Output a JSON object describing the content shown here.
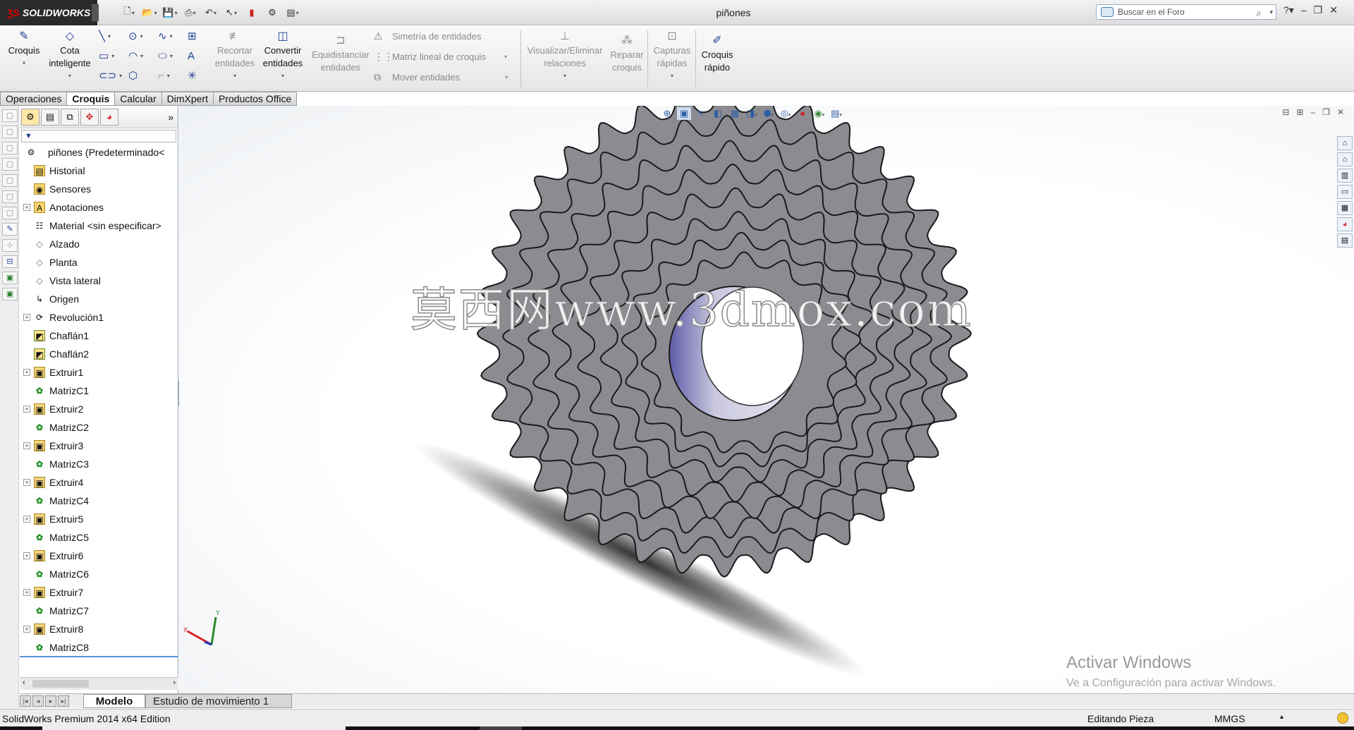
{
  "app": {
    "brand": "SOLIDWORKS",
    "doc_title": "piñones",
    "search_placeholder": "Buscar en el Foro"
  },
  "quick_toolbar": [
    "new-document-icon",
    "open-icon",
    "save-icon",
    "print-icon",
    "undo-icon",
    "select-icon",
    "rebuild-icon",
    "options-icon",
    "customize-icon"
  ],
  "ribbon": {
    "croquis": "Croquis",
    "cota": "Cota inteligente",
    "recortar": "Recortar entidades",
    "convertir": "Convertir entidades",
    "equidistanciar": "Equidistanciar entidades",
    "simetria": "Simetría de entidades",
    "matriz_lineal": "Matriz lineal de croquis",
    "mover": "Mover entidades",
    "visualizar": "Visualizar/Eliminar relaciones",
    "reparar": "Reparar croquis",
    "capturas": "Capturas rápidas",
    "croquis_rapido": "Croquis rápido"
  },
  "command_tabs": [
    "Operaciones",
    "Croquis",
    "Calcular",
    "DimXpert",
    "Productos Office"
  ],
  "active_tab": "Croquis",
  "tree": {
    "root": "piñones  (Predeterminado<",
    "items": [
      {
        "label": "Historial",
        "icon": "history-folder-icon",
        "expand": false
      },
      {
        "label": "Sensores",
        "icon": "sensor-folder-icon",
        "expand": false
      },
      {
        "label": "Anotaciones",
        "icon": "annotations-icon",
        "expand": true
      },
      {
        "label": "Material <sin especificar>",
        "icon": "material-icon",
        "expand": false
      },
      {
        "label": "Alzado",
        "icon": "plane-icon",
        "expand": false
      },
      {
        "label": "Planta",
        "icon": "plane-icon",
        "expand": false
      },
      {
        "label": "Vista lateral",
        "icon": "plane-icon",
        "expand": false
      },
      {
        "label": "Origen",
        "icon": "origin-icon",
        "expand": false
      },
      {
        "label": "Revolución1",
        "icon": "revolve-icon",
        "expand": true
      },
      {
        "label": "Chaflán1",
        "icon": "chamfer-icon",
        "expand": false
      },
      {
        "label": "Chaflán2",
        "icon": "chamfer-icon",
        "expand": false
      },
      {
        "label": "Extruir1",
        "icon": "extrude-icon",
        "expand": true
      },
      {
        "label": "MatrizC1",
        "icon": "circular-pattern-icon",
        "expand": false
      },
      {
        "label": "Extruir2",
        "icon": "extrude-icon",
        "expand": true
      },
      {
        "label": "MatrizC2",
        "icon": "circular-pattern-icon",
        "expand": false
      },
      {
        "label": "Extruir3",
        "icon": "extrude-icon",
        "expand": true
      },
      {
        "label": "MatrizC3",
        "icon": "circular-pattern-icon",
        "expand": false
      },
      {
        "label": "Extruir4",
        "icon": "extrude-icon",
        "expand": true
      },
      {
        "label": "MatrizC4",
        "icon": "circular-pattern-icon",
        "expand": false
      },
      {
        "label": "Extruir5",
        "icon": "extrude-icon",
        "expand": true
      },
      {
        "label": "MatrizC5",
        "icon": "circular-pattern-icon",
        "expand": false
      },
      {
        "label": "Extruir6",
        "icon": "extrude-icon",
        "expand": true
      },
      {
        "label": "MatrizC6",
        "icon": "circular-pattern-icon",
        "expand": false
      },
      {
        "label": "Extruir7",
        "icon": "extrude-icon",
        "expand": true
      },
      {
        "label": "MatrizC7",
        "icon": "circular-pattern-icon",
        "expand": false
      },
      {
        "label": "Extruir8",
        "icon": "extrude-icon",
        "expand": true
      },
      {
        "label": "MatrizC8",
        "icon": "circular-pattern-icon",
        "expand": false
      }
    ]
  },
  "watermark": "莫西网www.3dmox.com",
  "activation": {
    "title": "Activar Windows",
    "subtitle": "Ve a Configuración para activar Windows."
  },
  "bottom_tabs": {
    "model": "Modelo",
    "motion": "Estudio de movimiento 1"
  },
  "status": {
    "edition": "SolidWorks Premium 2014 x64 Edition",
    "mode": "Editando Pieza",
    "units": "MMGS"
  },
  "colors": {
    "gear_fill": "#8c8b92",
    "gear_edge": "#1a1a1a",
    "ribbon_icon": "#1b3e92",
    "tree_selection_line": "#5b8ed6"
  }
}
